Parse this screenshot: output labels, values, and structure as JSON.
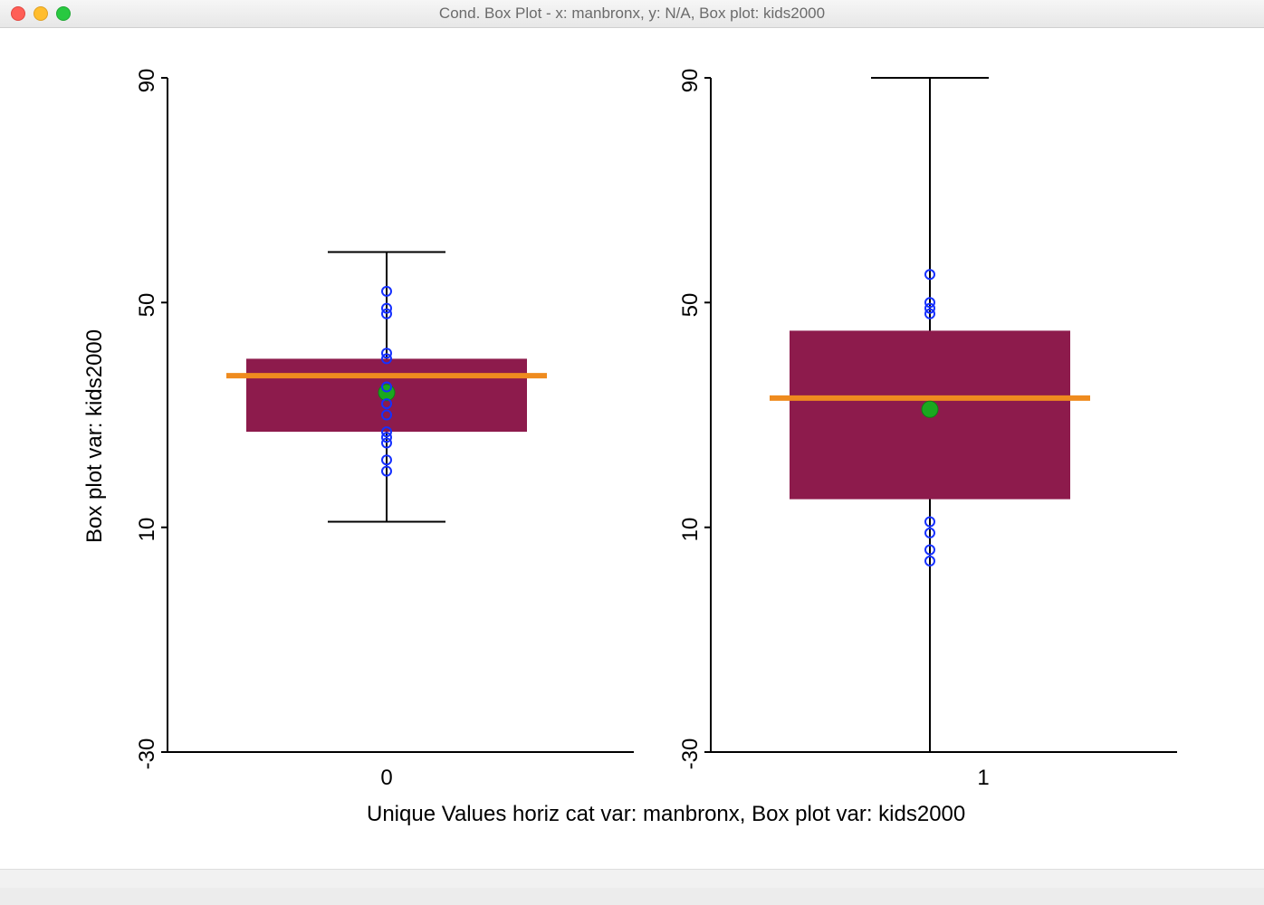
{
  "window": {
    "title": "Cond. Box Plot - x: manbronx, y: N/A, Box plot: kids2000"
  },
  "axes": {
    "ylabel": "Box plot var: kids2000",
    "xlabel": "Unique Values horiz cat var: manbronx,   Box plot var: kids2000",
    "yticks": [
      "-30",
      "10",
      "50",
      "90"
    ]
  },
  "categories": {
    "left": "0",
    "right": "1"
  },
  "chart_data": {
    "type": "boxplot",
    "x_variable": "manbronx",
    "y_variable": "kids2000",
    "ylim": [
      -30,
      90
    ],
    "yticks": [
      -30,
      10,
      50,
      90
    ],
    "series": [
      {
        "name": "0",
        "q1": 27,
        "median": 37,
        "q3": 40,
        "whisker_low": 11,
        "whisker_high": 59,
        "mean": 34,
        "points": [
          20,
          22,
          25,
          26,
          27,
          30,
          32,
          35,
          40,
          41,
          48,
          49,
          52
        ]
      },
      {
        "name": "1",
        "q1": 15,
        "median": 33,
        "q3": 45,
        "whisker_low": -30,
        "whisker_high": 90,
        "mean": 31,
        "points": [
          4,
          6,
          9,
          11,
          48,
          49,
          50,
          55
        ]
      }
    ],
    "title": "Cond. Box Plot - x: manbronx, y: N/A, Box plot: kids2000",
    "xlabel": "Unique Values horiz cat var: manbronx,   Box plot var: kids2000",
    "ylabel": "Box plot var: kids2000"
  }
}
